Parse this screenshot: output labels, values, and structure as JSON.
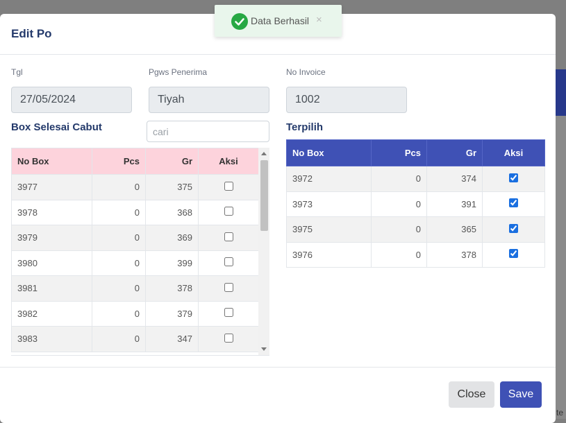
{
  "background": {
    "fragment_text": "te"
  },
  "modal": {
    "title": "Edit Po",
    "fields": {
      "tgl": {
        "label": "Tgl",
        "value": "27/05/2024"
      },
      "pgws": {
        "label": "Pgws Penerima",
        "value": "Tiyah"
      },
      "invoice": {
        "label": "No Invoice",
        "value": "1002"
      }
    },
    "left_section": {
      "title": "Box Selesai Cabut",
      "search_placeholder": "cari",
      "headers": [
        "No Box",
        "Pcs",
        "Gr",
        "Aksi"
      ],
      "rows": [
        {
          "no_box": "3977",
          "pcs": "0",
          "gr": "375",
          "checked": false
        },
        {
          "no_box": "3978",
          "pcs": "0",
          "gr": "368",
          "checked": false
        },
        {
          "no_box": "3979",
          "pcs": "0",
          "gr": "369",
          "checked": false
        },
        {
          "no_box": "3980",
          "pcs": "0",
          "gr": "399",
          "checked": false
        },
        {
          "no_box": "3981",
          "pcs": "0",
          "gr": "378",
          "checked": false
        },
        {
          "no_box": "3982",
          "pcs": "0",
          "gr": "379",
          "checked": false
        },
        {
          "no_box": "3983",
          "pcs": "0",
          "gr": "347",
          "checked": false
        }
      ]
    },
    "right_section": {
      "title": "Terpilih",
      "headers": [
        "No Box",
        "Pcs",
        "Gr",
        "Aksi"
      ],
      "rows": [
        {
          "no_box": "3972",
          "pcs": "0",
          "gr": "374",
          "checked": true
        },
        {
          "no_box": "3973",
          "pcs": "0",
          "gr": "391",
          "checked": true
        },
        {
          "no_box": "3975",
          "pcs": "0",
          "gr": "365",
          "checked": true
        },
        {
          "no_box": "3976",
          "pcs": "0",
          "gr": "378",
          "checked": true
        }
      ]
    },
    "buttons": {
      "close": "Close",
      "save": "Save"
    }
  },
  "toast": {
    "message": "Data Berhasil",
    "close_symbol": "×",
    "icon": "check-circle-icon"
  },
  "colors": {
    "accent": "#3f51b5",
    "left_header": "#fdd3dc",
    "toast_icon": "#27a844",
    "title": "#243a6b"
  }
}
